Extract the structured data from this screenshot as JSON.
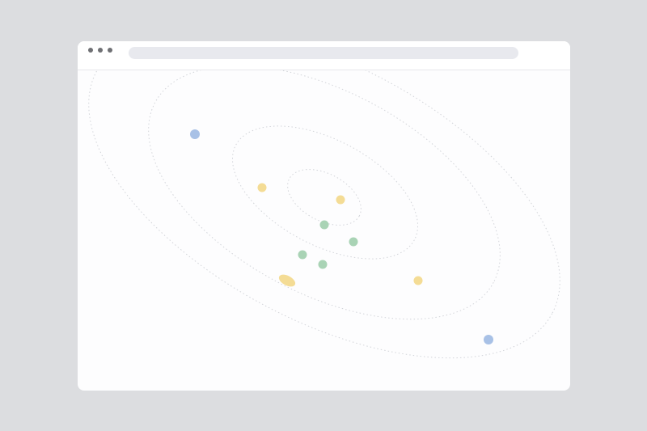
{
  "window": {
    "controls": [
      {
        "name": "close-dot",
        "color": "#6f7074"
      },
      {
        "name": "minimize-dot",
        "color": "#6f7074"
      },
      {
        "name": "maximize-dot",
        "color": "#6f7074"
      }
    ],
    "address_bar": {
      "text": "",
      "color": "#e8e9ee"
    }
  },
  "colors": {
    "page_background": "#dcdde0",
    "window_background": "#fdfdfe",
    "orbit_stroke": "#d2d4d9",
    "blue": "#a8c1e6",
    "yellow": "#f4dc95",
    "green": "#a9d3b5"
  },
  "orbits": [
    {
      "name": "orbit-ring-inner"
    },
    {
      "name": "orbit-ring-middle"
    },
    {
      "name": "orbit-ring-outer-1"
    },
    {
      "name": "orbit-ring-outer-2"
    }
  ],
  "planets": [
    {
      "name": "planet-blue-top-left",
      "color": "#a8c1e6"
    },
    {
      "name": "planet-blue-bottom-right",
      "color": "#a8c1e6"
    },
    {
      "name": "planet-yellow-left",
      "color": "#f4dc95"
    },
    {
      "name": "planet-yellow-right-top",
      "color": "#f4dc95"
    },
    {
      "name": "planet-yellow-right-bottom",
      "color": "#f4dc95"
    },
    {
      "name": "planet-yellow-center",
      "color": "#f4dc95"
    },
    {
      "name": "planet-green-top",
      "color": "#a9d3b5"
    },
    {
      "name": "planet-green-right",
      "color": "#a9d3b5"
    },
    {
      "name": "planet-green-left",
      "color": "#a9d3b5"
    },
    {
      "name": "planet-green-bottom",
      "color": "#a9d3b5"
    }
  ]
}
